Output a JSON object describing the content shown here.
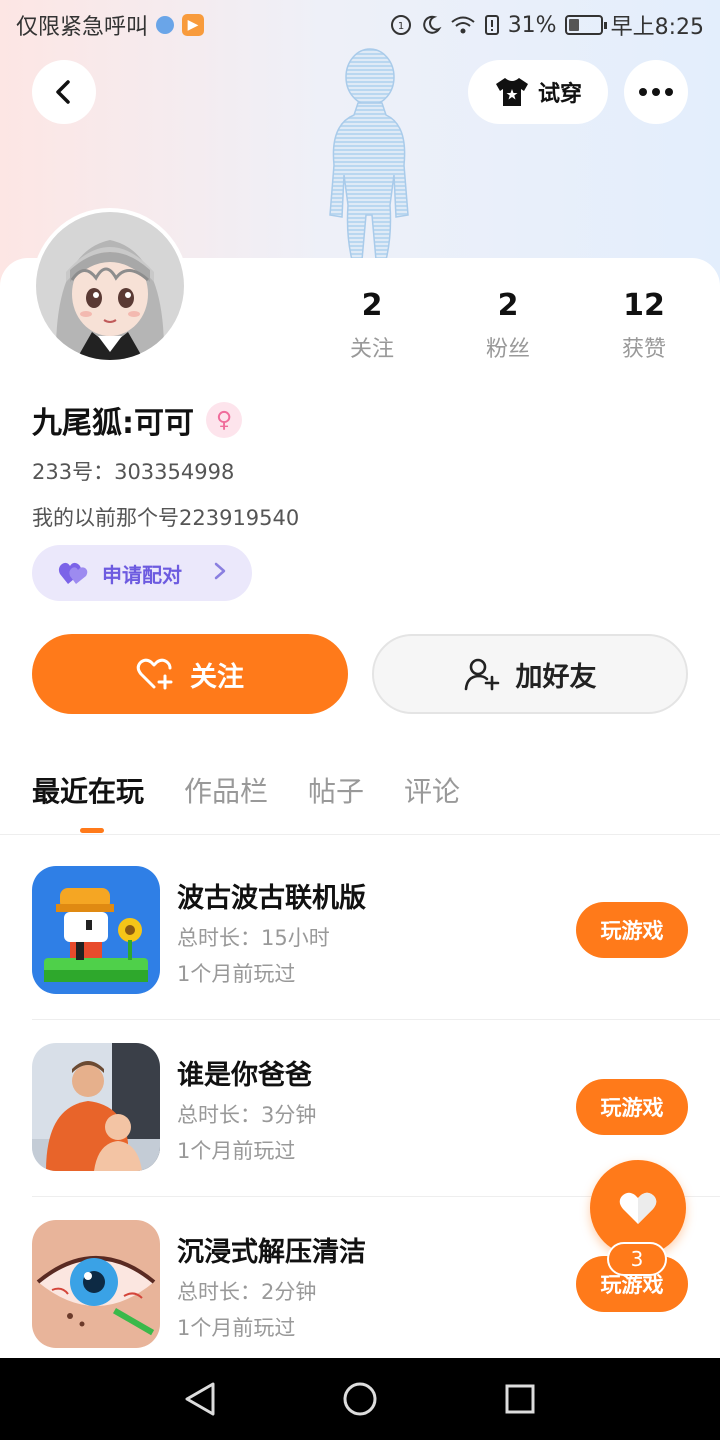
{
  "status_bar": {
    "carrier_text": "仅限紧急呼叫",
    "battery": "31%",
    "time": "早上8:25"
  },
  "header": {
    "tryon_label": "试穿"
  },
  "profile": {
    "stats": [
      {
        "value": "2",
        "label": "关注"
      },
      {
        "value": "2",
        "label": "粉丝"
      },
      {
        "value": "12",
        "label": "获赞"
      }
    ],
    "name": "九尾狐:可可",
    "gender_icon": "female-icon",
    "uid": "233号：303354998",
    "bio": "我的以前那个号223919540",
    "pair_label": "申请配对"
  },
  "actions": {
    "follow_label": "关注",
    "add_friend_label": "加好友"
  },
  "tabs": [
    {
      "label": "最近在玩",
      "active": true
    },
    {
      "label": "作品栏",
      "active": false
    },
    {
      "label": "帖子",
      "active": false
    },
    {
      "label": "评论",
      "active": false
    }
  ],
  "games": [
    {
      "title": "波古波古联机版",
      "duration": "总时长：15小时",
      "last_played": "1个月前玩过",
      "button": "玩游戏"
    },
    {
      "title": "谁是你爸爸",
      "duration": "总时长：3分钟",
      "last_played": "1个月前玩过",
      "button": "玩游戏"
    },
    {
      "title": "沉浸式解压清洁",
      "duration": "总时长：2分钟",
      "last_played": "1个月前玩过",
      "button": "玩游戏"
    }
  ],
  "fab": {
    "count": "3"
  },
  "colors": {
    "accent": "#ff7a1a",
    "pair_bg": "#ebe8fb",
    "pair_text": "#6d5be0"
  }
}
